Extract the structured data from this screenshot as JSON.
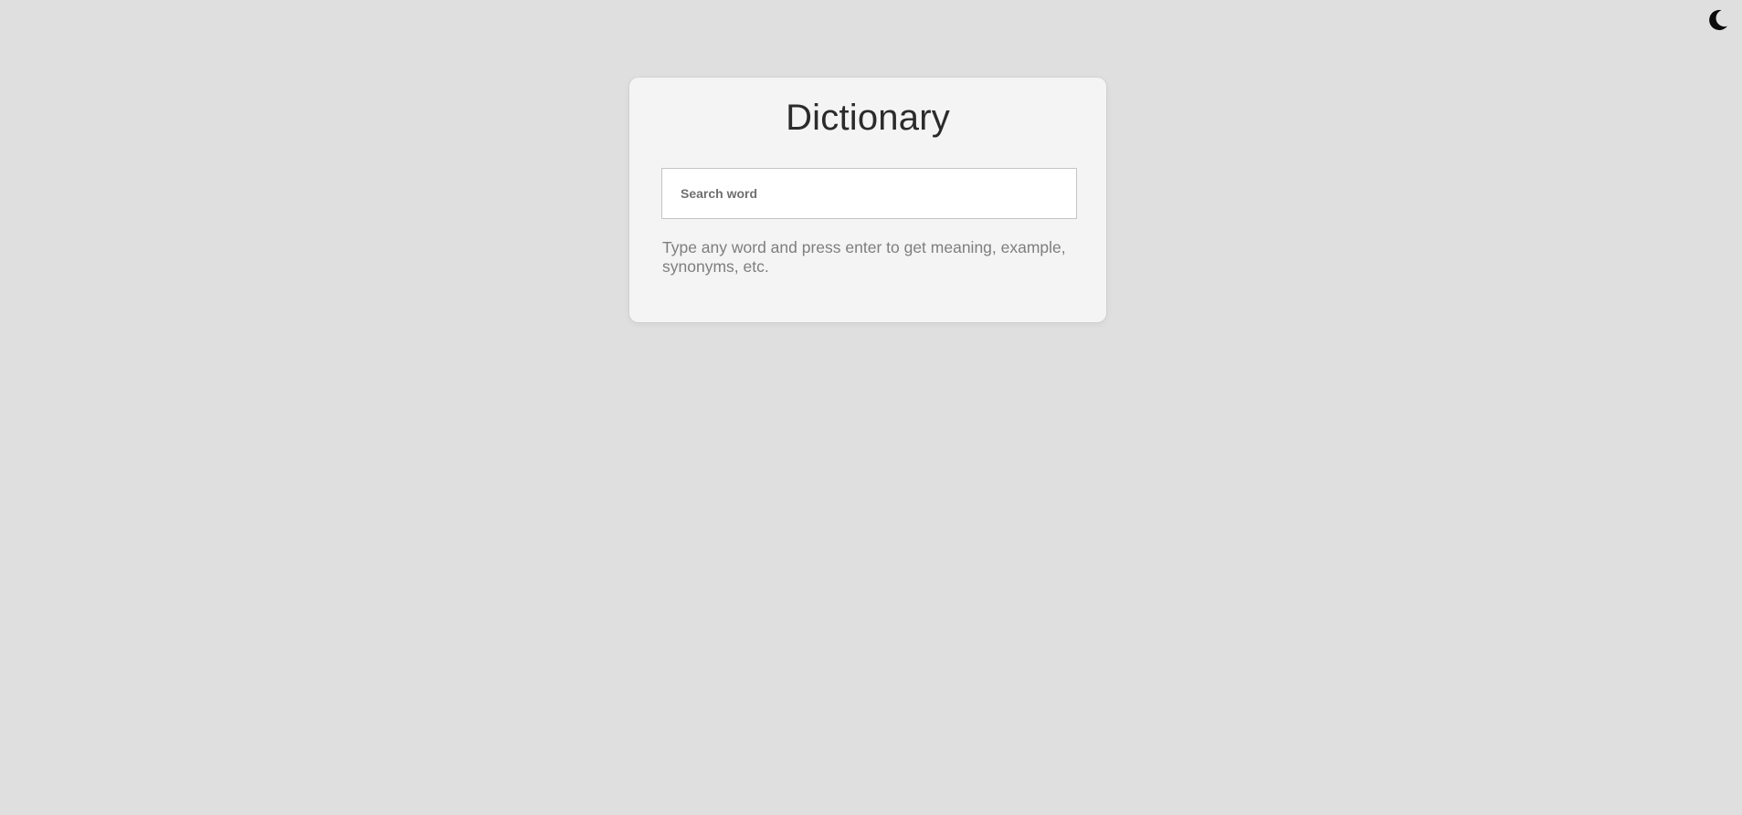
{
  "header": {
    "theme_toggle_icon": "moon-icon"
  },
  "app": {
    "title": "Dictionary",
    "search": {
      "placeholder": "Search word",
      "value": ""
    },
    "hint": "Type any word and press enter to get meaning, example, synonyms, etc."
  },
  "colors": {
    "background": "#dfdfdf",
    "card": "#f4f4f4",
    "title_text": "#2b2b2b",
    "hint_text": "#7e7e7e",
    "input_border": "#c5c5c5"
  }
}
